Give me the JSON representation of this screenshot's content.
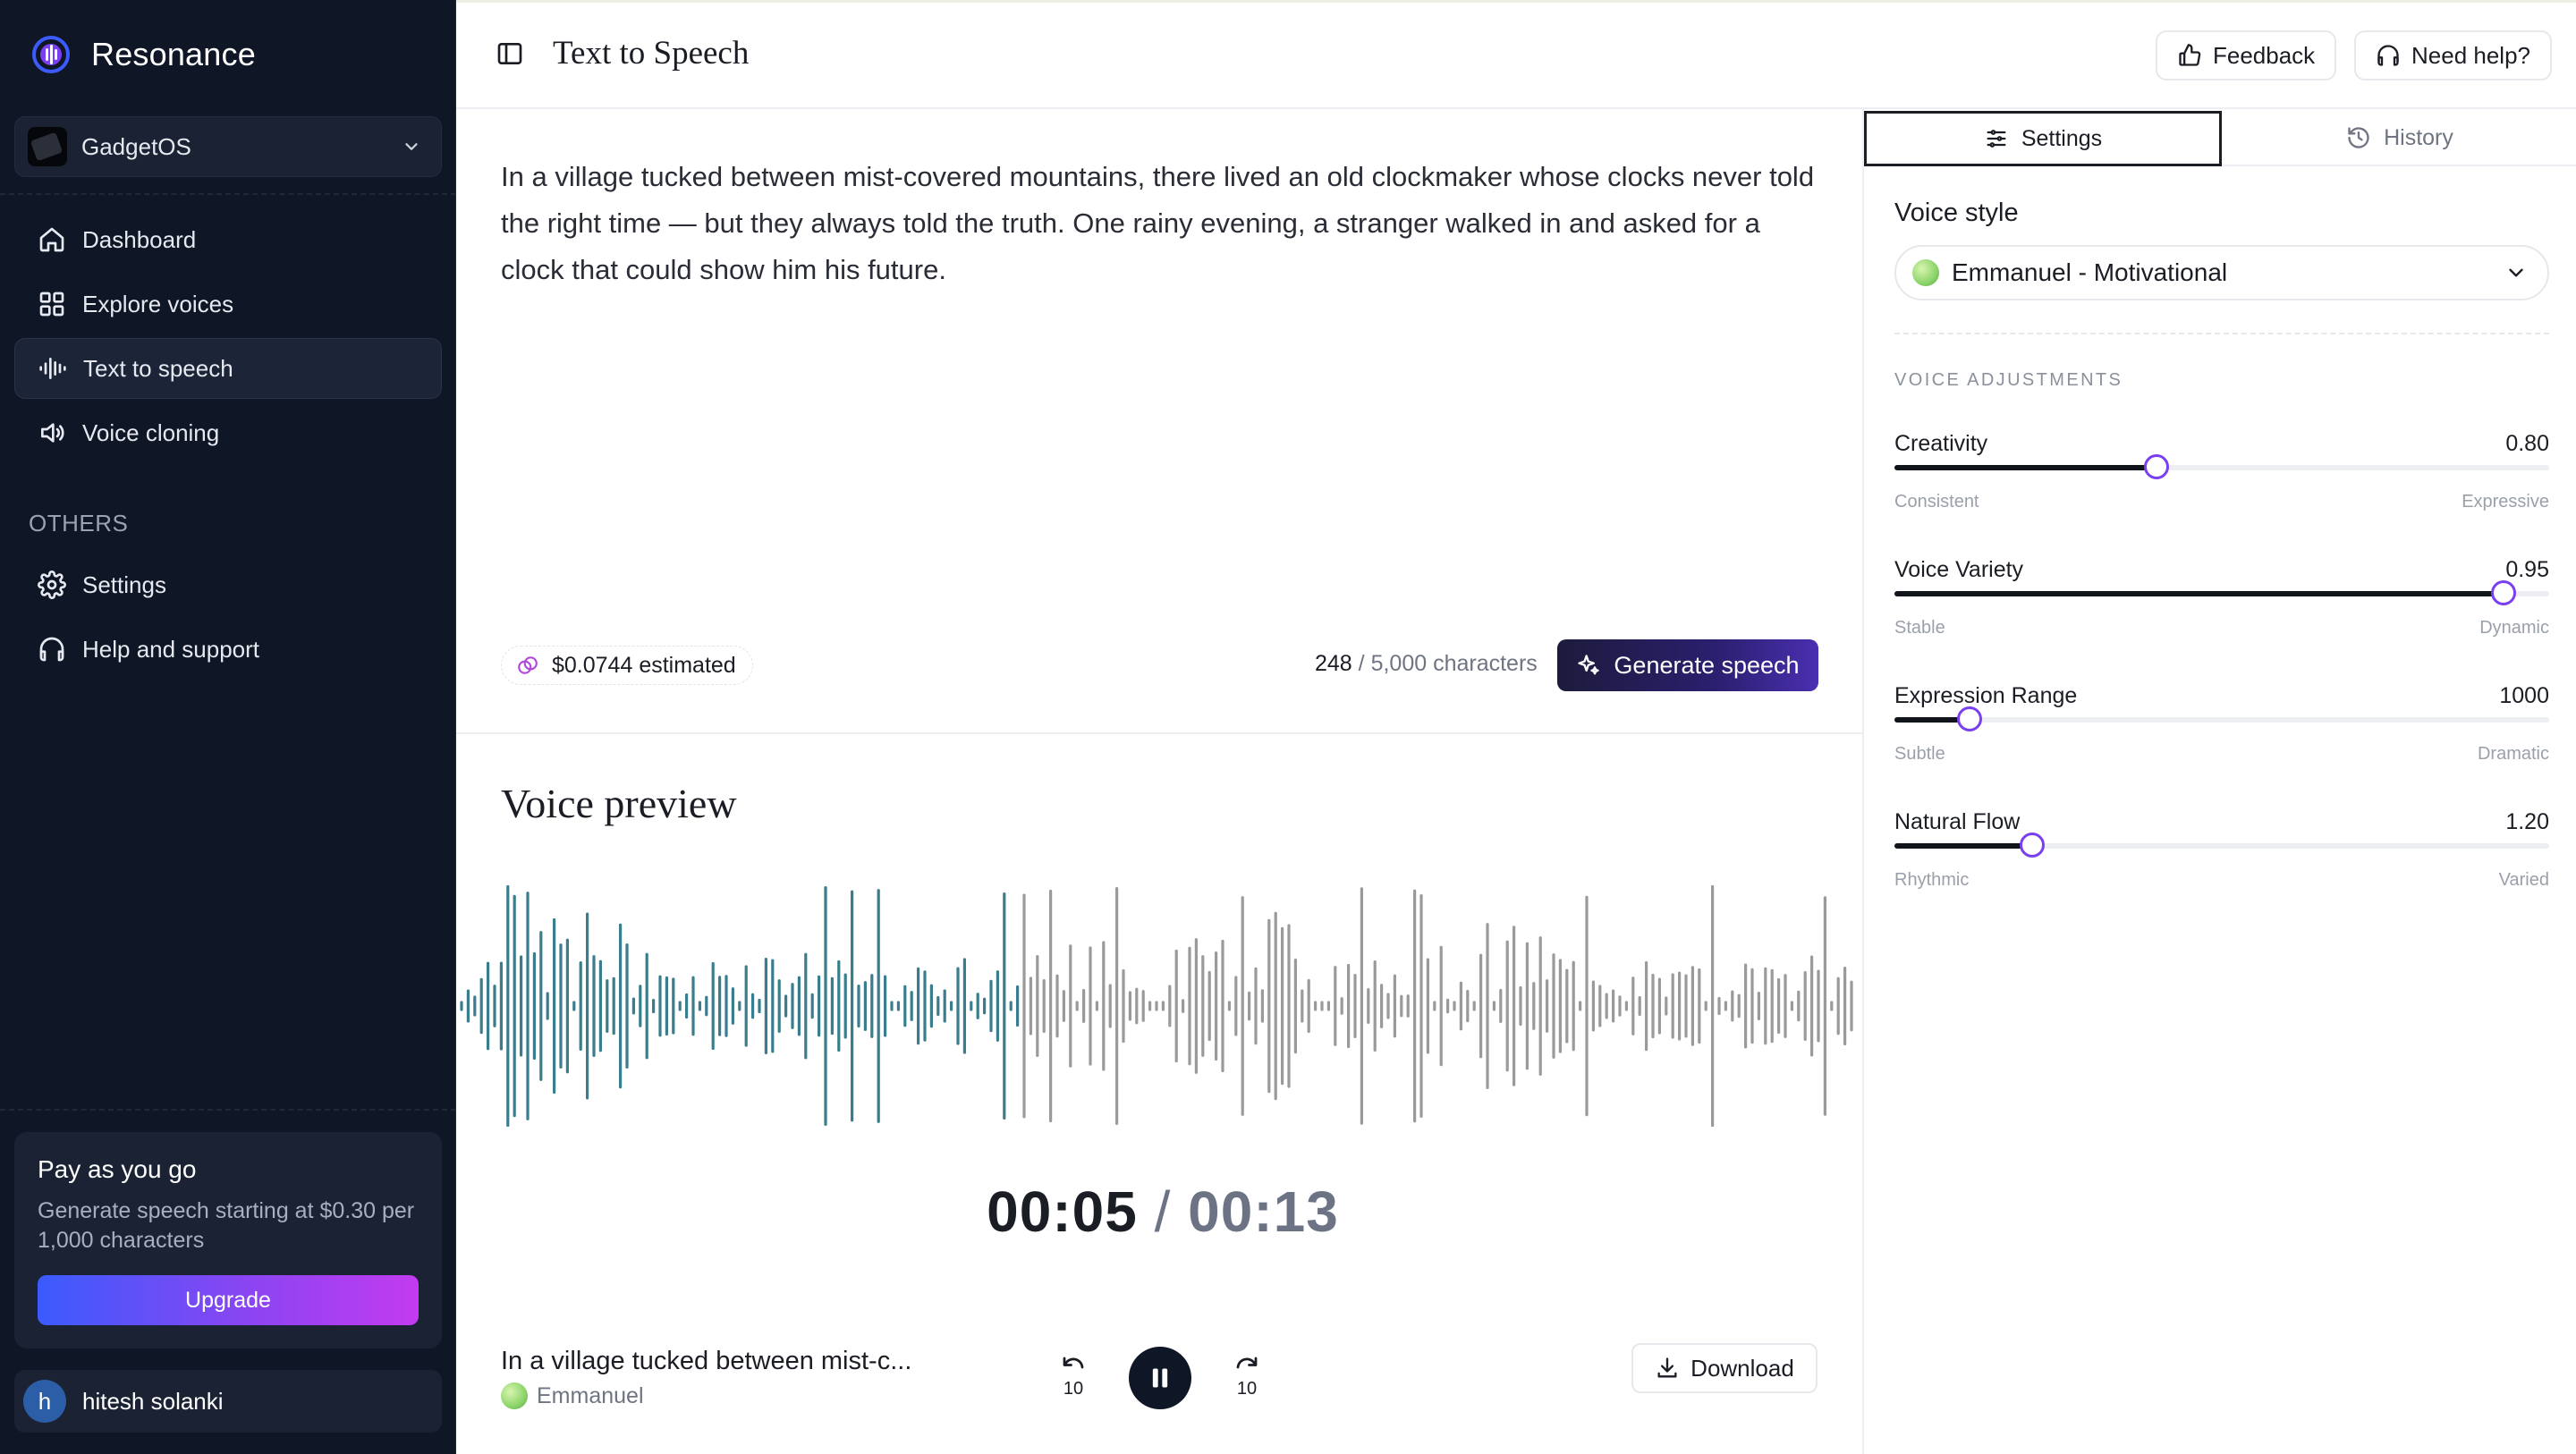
{
  "brand": {
    "name": "Resonance"
  },
  "org": {
    "name": "GadgetOS"
  },
  "nav": {
    "items": [
      {
        "label": "Dashboard",
        "icon": "home-icon"
      },
      {
        "label": "Explore voices",
        "icon": "grid-icon"
      },
      {
        "label": "Text to speech",
        "icon": "waveform-icon",
        "active": true
      },
      {
        "label": "Voice cloning",
        "icon": "speaker-icon"
      }
    ],
    "others_label": "OTHERS",
    "others": [
      {
        "label": "Settings",
        "icon": "gear-icon"
      },
      {
        "label": "Help and support",
        "icon": "headphones-icon"
      }
    ]
  },
  "promo": {
    "title": "Pay as you go",
    "text": "Generate speech starting at $0.30 per 1,000 characters",
    "button": "Upgrade"
  },
  "user": {
    "initial": "h",
    "name": "hitesh solanki"
  },
  "header": {
    "title": "Text to Speech",
    "feedback": "Feedback",
    "help": "Need help?"
  },
  "editor": {
    "text": "In a village tucked between mist-covered mountains, there lived an old clockmaker whose clocks never told the right time — but they always told the truth. One rainy evening, a stranger walked in and asked for a clock that could show him his future.",
    "cost": "$0.0744 estimated",
    "char_current": "248",
    "char_limit": "/ 5,000 characters",
    "generate": "Generate speech"
  },
  "preview": {
    "title": "Voice preview",
    "time_current": "00:05",
    "time_separator": "/",
    "time_total": "00:13",
    "progress": 0.4,
    "track_title": "In a village tucked between mist-c...",
    "voice": "Emmanuel",
    "skip_back": "10",
    "skip_forward": "10",
    "download": "Download",
    "colors": {
      "played": "#3a7d8c",
      "unplayed": "#9a9a9a"
    }
  },
  "settings": {
    "tabs": {
      "settings": "Settings",
      "history": "History"
    },
    "voice_style_label": "Voice style",
    "voice_style_value": "Emmanuel - Motivational",
    "adjust_title": "VOICE ADJUSTMENTS",
    "sliders": [
      {
        "name": "Creativity",
        "value": "0.80",
        "level": 0.4,
        "min_label": "Consistent",
        "max_label": "Expressive"
      },
      {
        "name": "Voice Variety",
        "value": "0.95",
        "level": 0.93,
        "min_label": "Stable",
        "max_label": "Dynamic"
      },
      {
        "name": "Expression Range",
        "value": "1000",
        "level": 0.115,
        "min_label": "Subtle",
        "max_label": "Dramatic"
      },
      {
        "name": "Natural Flow",
        "value": "1.20",
        "level": 0.21,
        "min_label": "Rhythmic",
        "max_label": "Varied"
      }
    ],
    "accent": "#7a3ff0"
  }
}
